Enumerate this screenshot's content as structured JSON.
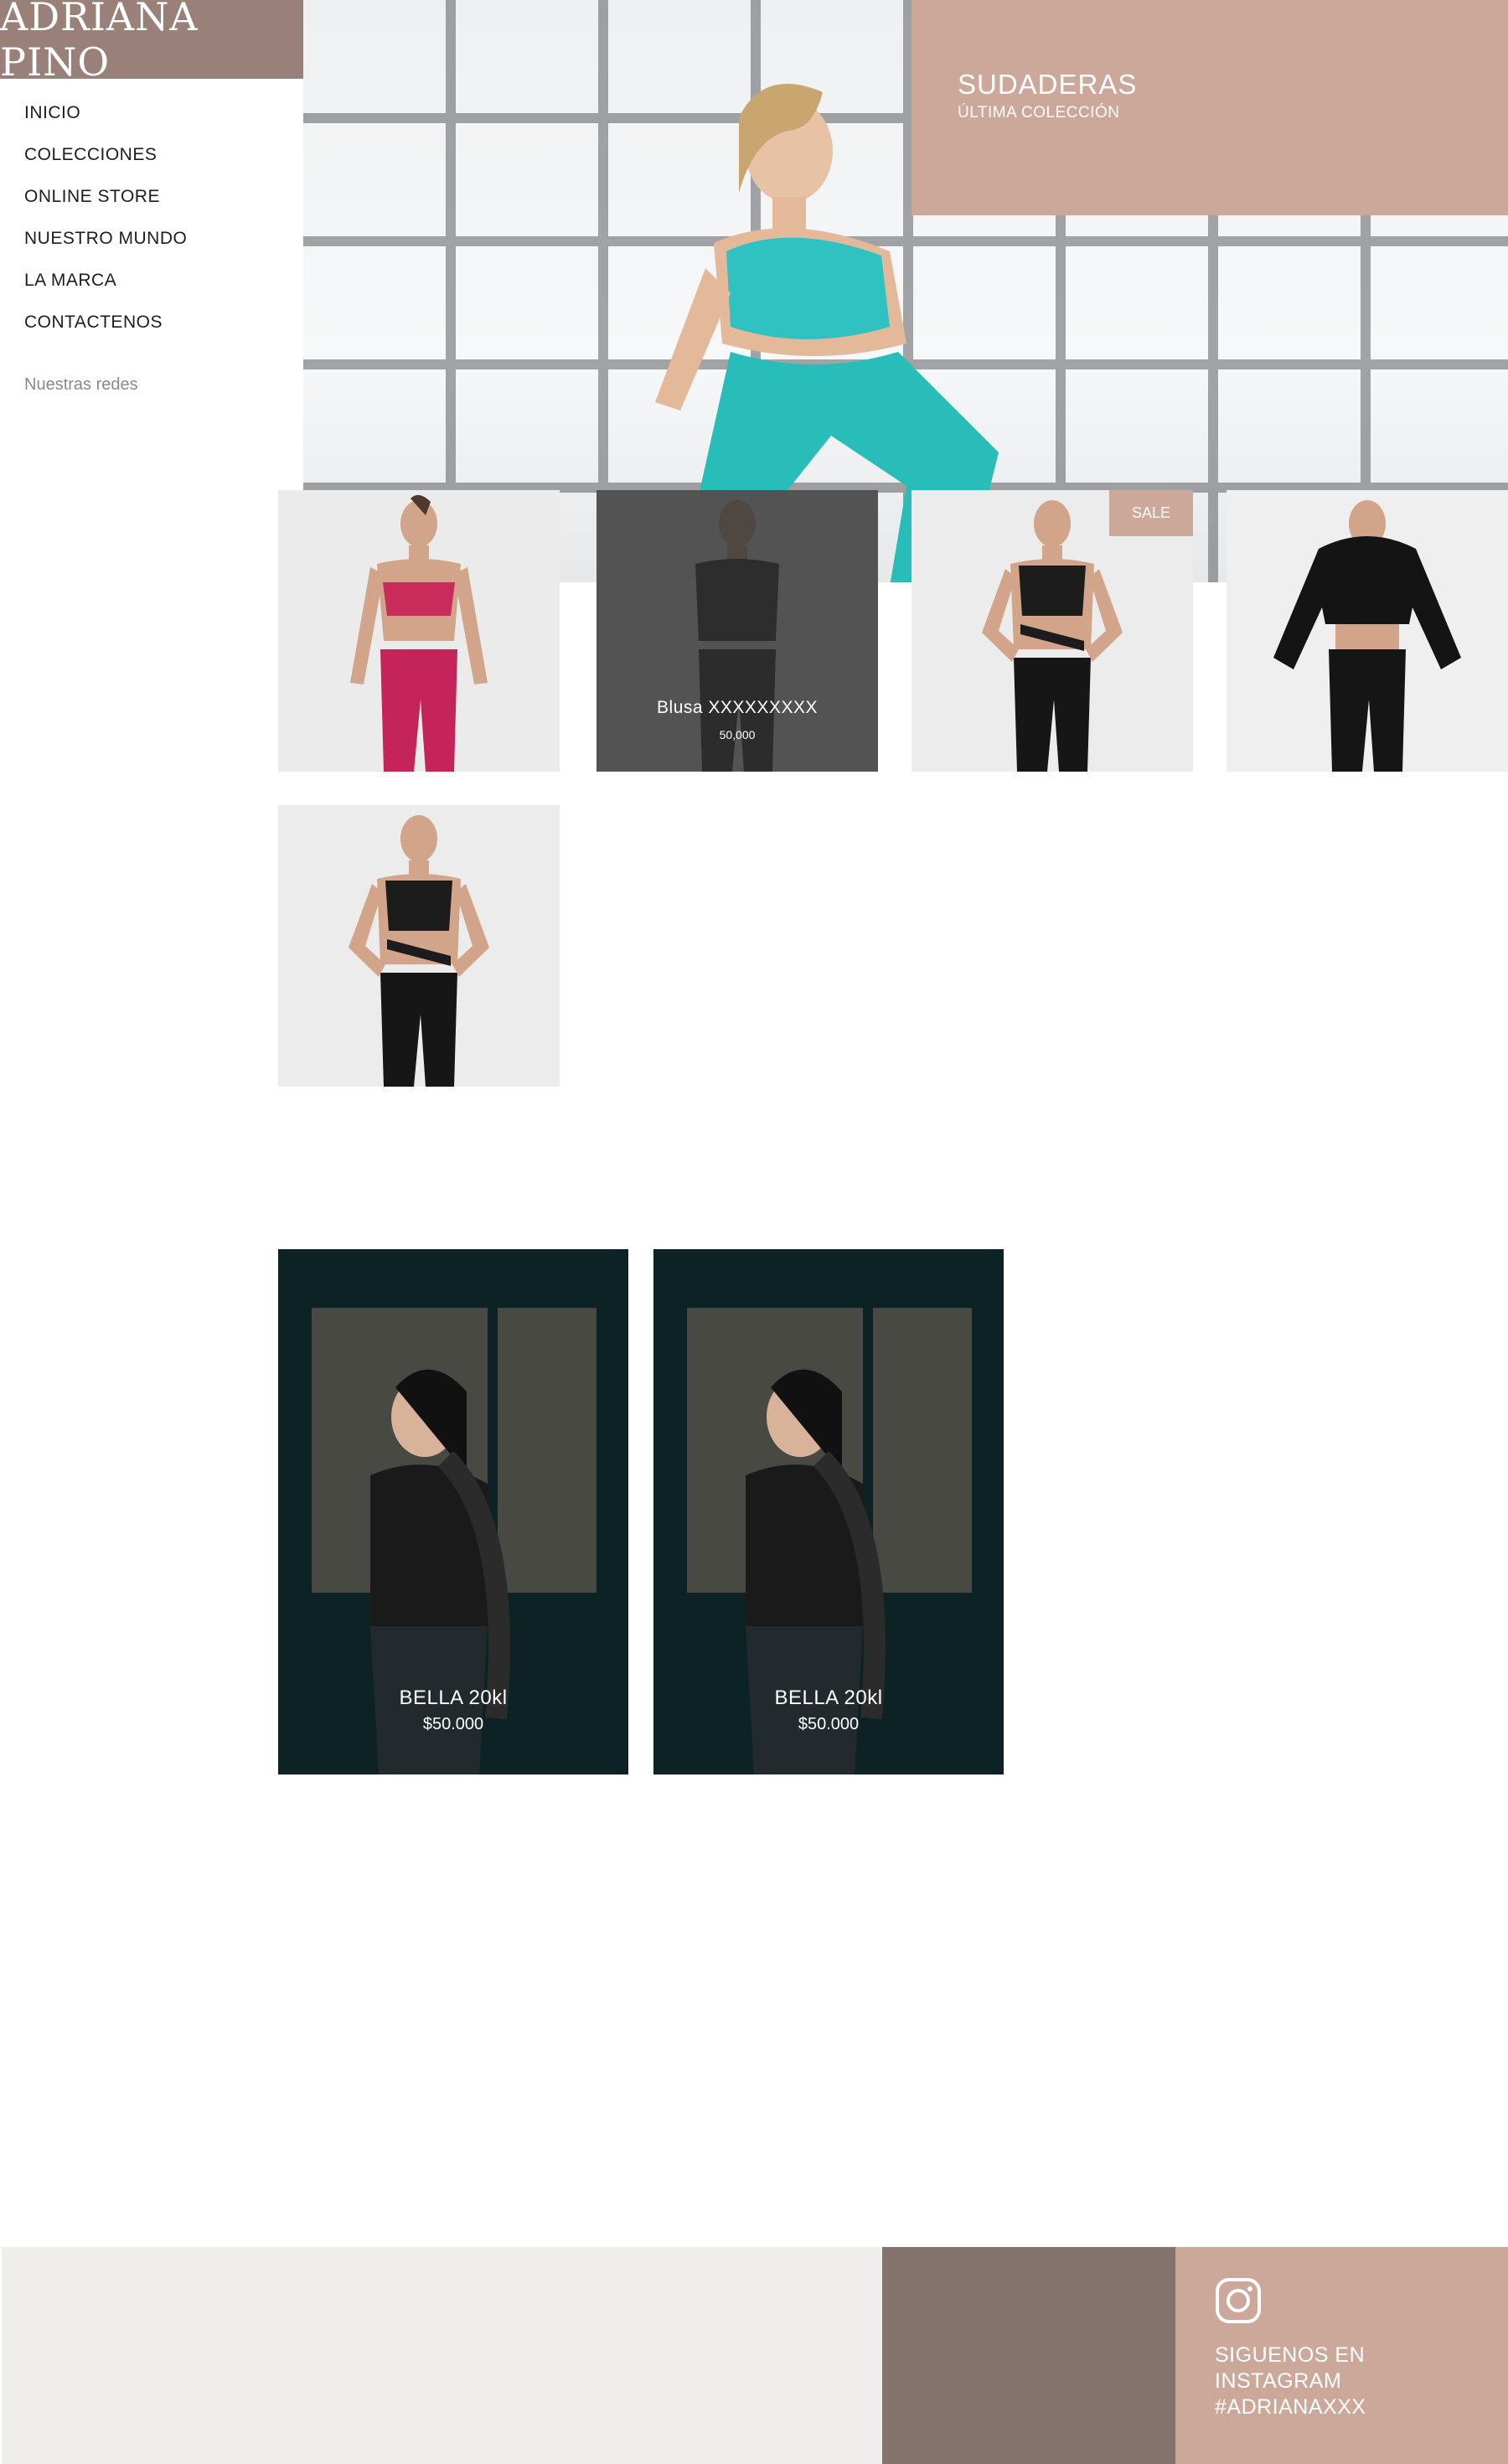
{
  "brand": {
    "logo_text": "ADRIANA PINO"
  },
  "nav": {
    "items": [
      {
        "label": "INICIO"
      },
      {
        "label": "COLECCIONES"
      },
      {
        "label": "ONLINE STORE"
      },
      {
        "label": "NUESTRO MUNDO"
      },
      {
        "label": "LA MARCA"
      },
      {
        "label": "CONTACTENOS"
      }
    ],
    "social_label": "Nuestras redes"
  },
  "hero": {
    "promo_title": "SUDADERAS",
    "promo_subtitle": "ÚLTIMA COLECCIÓN"
  },
  "products": [
    {
      "outfit": "pink-set"
    },
    {
      "outfit": "black-top",
      "hover_name": "Blusa XXXXXXXXX",
      "hover_price": "50,000"
    },
    {
      "outfit": "black-cross",
      "badge": "SALE"
    },
    {
      "outfit": "black-hoodie"
    },
    {
      "outfit": "black-cross"
    }
  ],
  "features": [
    {
      "name": "BELLA 20kl",
      "price": "$50.000"
    },
    {
      "name": "BELLA 20kl",
      "price": "$50.000"
    }
  ],
  "footer": {
    "instagram_lines": [
      "SIGUENOS EN",
      "INSTAGRAM",
      "#ADRIANAXXX"
    ]
  },
  "colors": {
    "logo_bg": "#998079",
    "accent_rose": "#cca89b",
    "footer_taupe": "#85746e",
    "footer_light": "#efeeec",
    "overlay_dark": "#323232"
  },
  "icons": {
    "instagram": "instagram-icon"
  }
}
